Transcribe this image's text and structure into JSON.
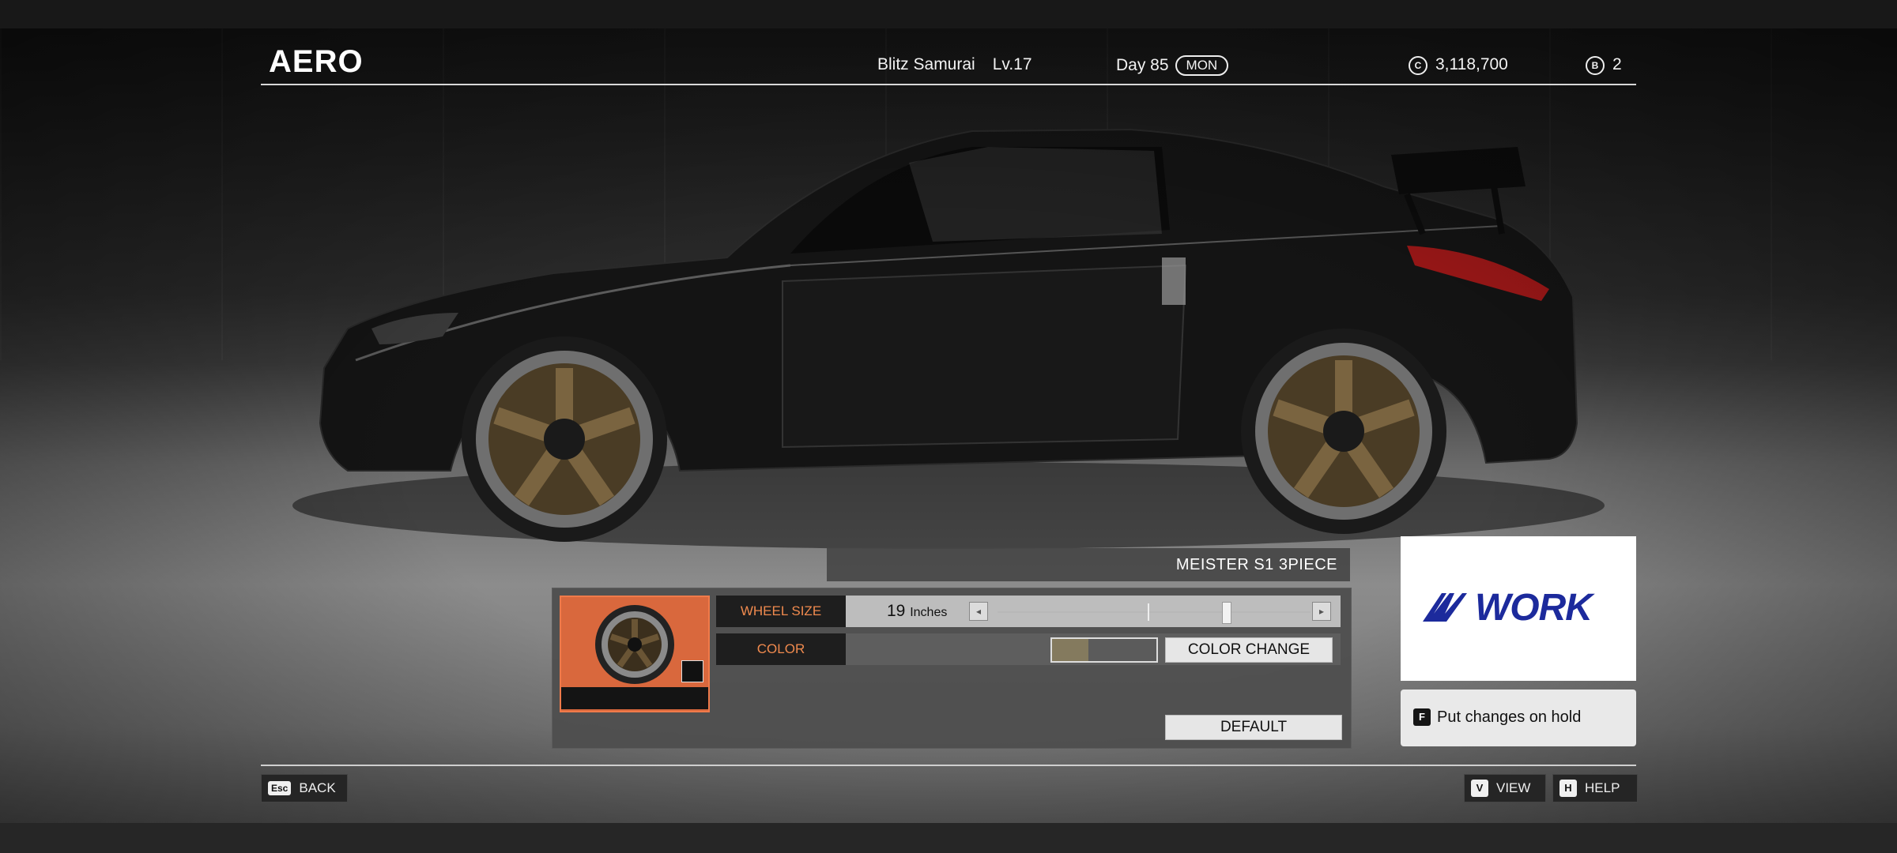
{
  "header": {
    "title": "AERO",
    "car_name": "Blitz Samurai",
    "level": "Lv.17",
    "day": "Day 85",
    "weekday": "MON",
    "credits_icon": "C",
    "credits": "3,118,700",
    "b_icon": "B",
    "b_count": "2"
  },
  "part": {
    "name": "MEISTER S1 3PIECE",
    "brand_logo": "WORK"
  },
  "wheel_size": {
    "label": "WHEEL SIZE",
    "value": "19",
    "unit": "Inches",
    "slider_position": 0.73
  },
  "color": {
    "label": "COLOR",
    "swatch_color": "#847a5e",
    "swatch_fill": 0.35,
    "change_button": "COLOR CHANGE"
  },
  "default_button": "DEFAULT",
  "hold": {
    "key": "F",
    "label": "Put changes on hold"
  },
  "footer": {
    "back_key": "Esc",
    "back_label": "BACK",
    "view_key": "V",
    "view_label": "VIEW",
    "help_key": "H",
    "help_label": "HELP"
  },
  "colors": {
    "accent_orange": "#f08a4e",
    "thumb_bg": "#d9683d",
    "logo_blue": "#1c2a9c"
  }
}
